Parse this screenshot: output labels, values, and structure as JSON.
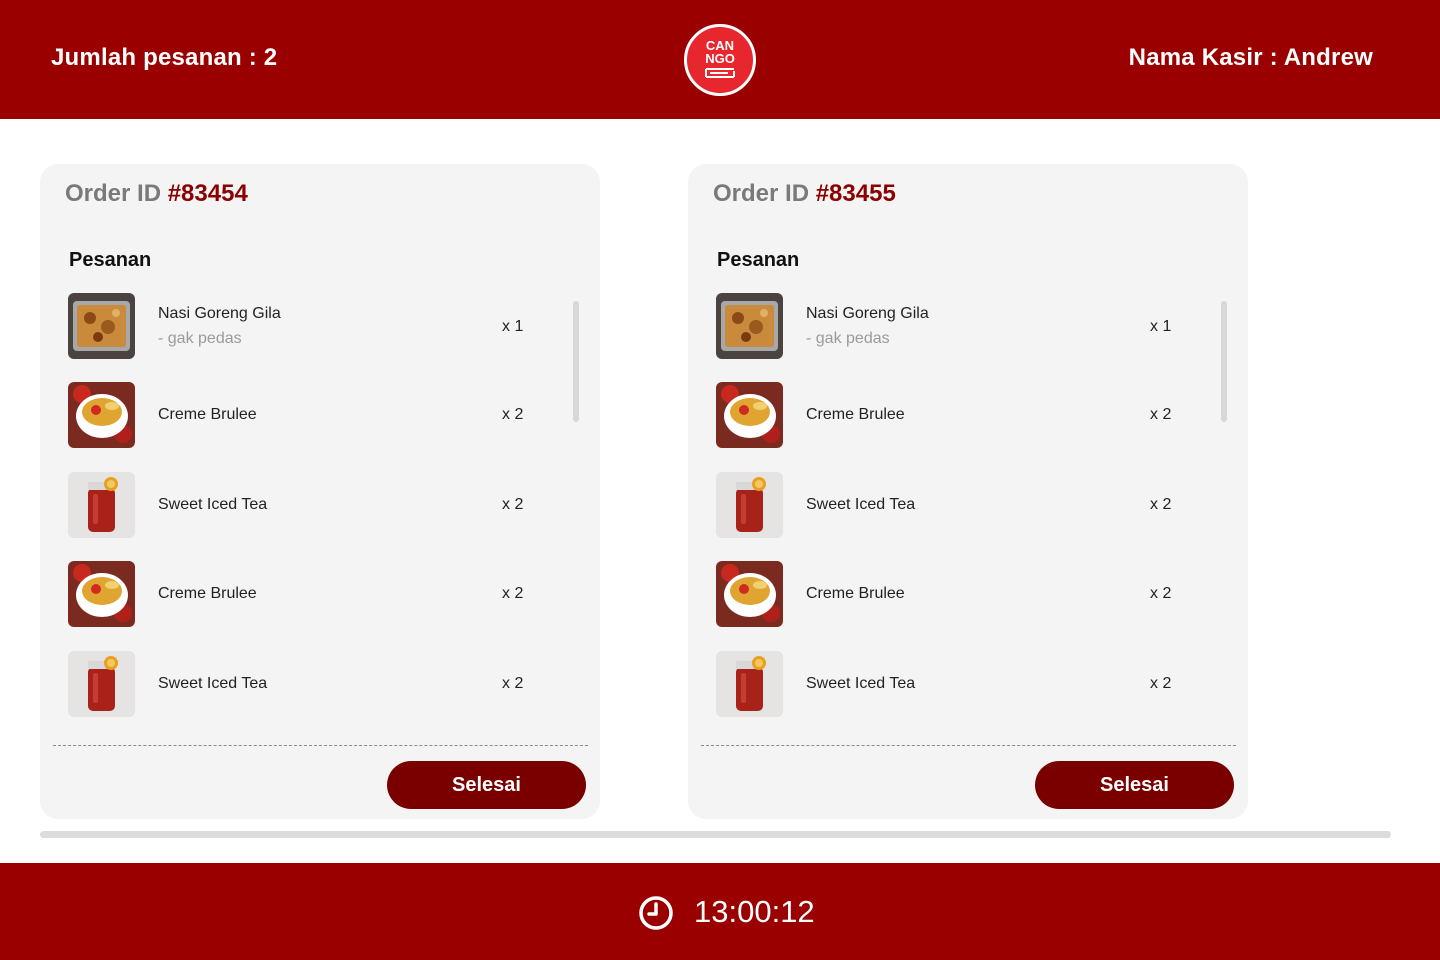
{
  "header": {
    "order_count_label": "Jumlah pesanan : 2",
    "cashier_label": "Nama Kasir : Andrew",
    "logo": {
      "line1": "CAN",
      "line2": "NGO"
    }
  },
  "orders": [
    {
      "id_label": "Order ID ",
      "id": "#83454",
      "section_title": "Pesanan",
      "items": [
        {
          "name": "Nasi Goreng Gila",
          "note": "- gak pedas",
          "qty": "x 1",
          "image": "fried-rice-icon"
        },
        {
          "name": "Creme Brulee",
          "qty": "x 2",
          "image": "creme-brulee-icon"
        },
        {
          "name": "Sweet Iced Tea",
          "qty": "x 2",
          "image": "iced-tea-icon"
        },
        {
          "name": "Creme Brulee",
          "qty": "x 2",
          "image": "creme-brulee-icon"
        },
        {
          "name": "Sweet Iced Tea",
          "qty": "x 2",
          "image": "iced-tea-icon"
        }
      ],
      "button": "Selesai"
    },
    {
      "id_label": "Order ID ",
      "id": "#83455",
      "section_title": "Pesanan",
      "items": [
        {
          "name": "Nasi Goreng Gila",
          "note": "- gak pedas",
          "qty": "x 1",
          "image": "fried-rice-icon"
        },
        {
          "name": "Creme Brulee",
          "qty": "x 2",
          "image": "creme-brulee-icon"
        },
        {
          "name": "Sweet Iced Tea",
          "qty": "x 2",
          "image": "iced-tea-icon"
        },
        {
          "name": "Creme Brulee",
          "qty": "x 2",
          "image": "creme-brulee-icon"
        },
        {
          "name": "Sweet Iced Tea",
          "qty": "x 2",
          "image": "iced-tea-icon"
        }
      ],
      "button": "Selesai"
    }
  ],
  "footer": {
    "time": "13:00:12",
    "icon": "clock-icon"
  },
  "colors": {
    "brand_red": "#9b0000",
    "button_dark_red": "#7a0000",
    "logo_red": "#e8262e",
    "card_bg": "#f4f4f4"
  }
}
